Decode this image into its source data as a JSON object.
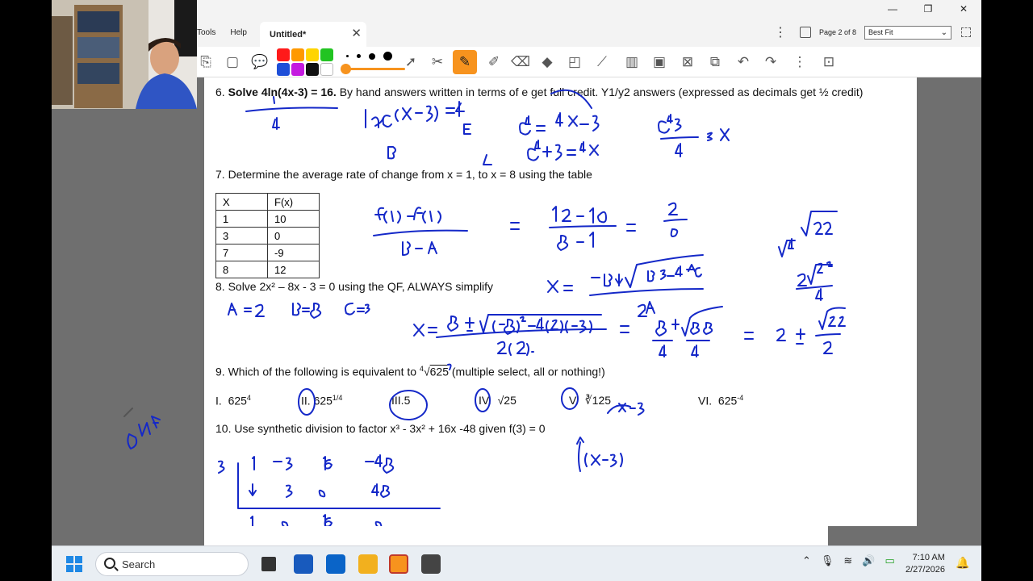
{
  "window": {
    "menu": [
      "Tools",
      "Help"
    ],
    "tab_title": "Untitled*",
    "page_indicator": "Page 2 of 8",
    "zoom": "Best Fit"
  },
  "colors": {
    "accent": "#f7931e",
    "ink": "#1428c8",
    "swatches": [
      "#ff1a1a",
      "#ff9900",
      "#ffd400",
      "#22c422",
      "#1e4fd8",
      "#c41ae0",
      "#111111",
      "#ffffff"
    ]
  },
  "toolbar_icons": [
    "page-nav-icon",
    "page-blank-icon",
    "chat-icon",
    "cursor-icon",
    "tools-icon",
    "pen-icon",
    "highlighter-icon",
    "eraser-icon",
    "fill-icon",
    "shapes-icon",
    "line-icon",
    "pages-icon",
    "image-icon",
    "delete-icon",
    "copy-icon",
    "undo-icon",
    "redo-icon",
    "more-icon",
    "screen-icon"
  ],
  "document": {
    "q6_num": "6.",
    "q6_bold": "Solve 4ln(4x-3) = 16.",
    "q6_rest": " By hand answers written in terms of e get full credit. Y1/y2 answers (expressed as decimals get ½ credit)",
    "q7": "7.  Determine the average rate of change from x = 1, to x = 8 using the table",
    "table_header": [
      "X",
      "F(x)"
    ],
    "table_rows": [
      [
        "1",
        "10"
      ],
      [
        "3",
        "0"
      ],
      [
        "7",
        "-9"
      ],
      [
        "8",
        "12"
      ]
    ],
    "q8": "8. Solve  2x² – 8x - 3 = 0 using the QF, ALWAYS simplify",
    "q9_a": "9. Which of the following is equivalent to ",
    "q9_root_index": "4",
    "q9_radicand": "625",
    "q9_b": " (multiple select, all or nothing!)",
    "choices": [
      {
        "label": "I.",
        "base": "625",
        "sup": "4"
      },
      {
        "label": "II.",
        "base": "625",
        "sup": "1/4"
      },
      {
        "label": "III.",
        "base": "5",
        "sup": ""
      },
      {
        "label": "IV.",
        "base": "√25",
        "sup": ""
      },
      {
        "label": "V.",
        "base": "∛125",
        "sup": ""
      },
      {
        "label": "VI.",
        "base": "625",
        "sup": "-4"
      }
    ],
    "q10": "10.  Use synthetic division to factor  x³ - 3x² + 16x -48  given f(3) = 0"
  },
  "taskbar": {
    "search_placeholder": "Search",
    "time": "7:10 AM",
    "date": "2/27/2026"
  }
}
